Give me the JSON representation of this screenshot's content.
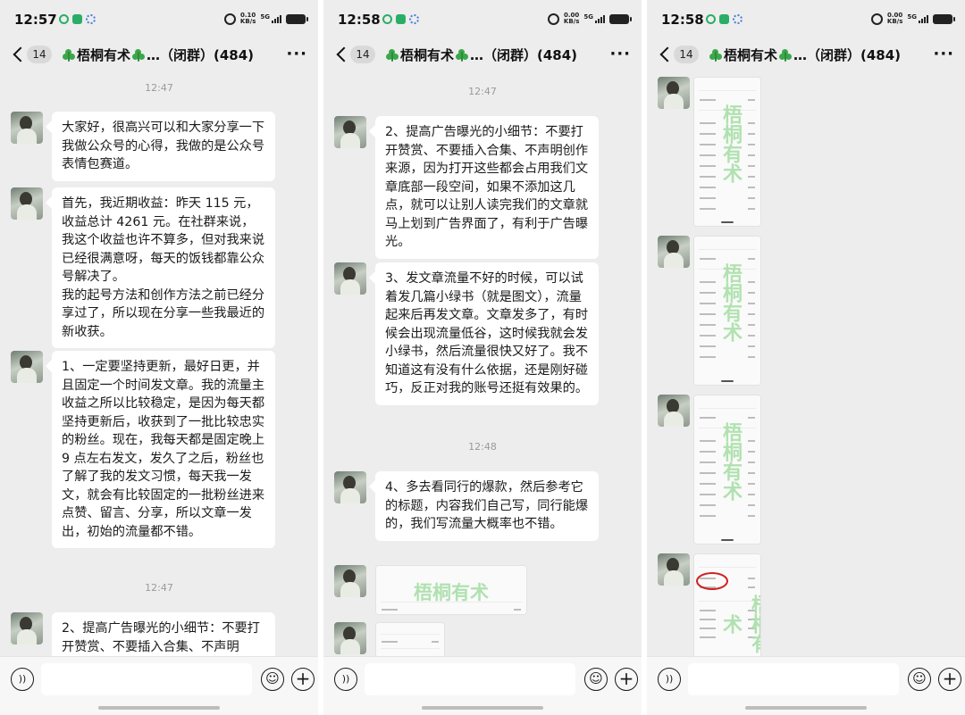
{
  "screens": [
    {
      "status": {
        "time": "12:57",
        "net_rate": "0.10",
        "net_unit": "KB/s",
        "net_type": "5G"
      },
      "nav": {
        "back_count": "14",
        "title": "梧桐有术",
        "title_suffix": "…（闭群）(484)"
      },
      "stamps": [
        "12:47",
        "12:47"
      ],
      "messages": [
        "大家好，很高兴可以和大家分享一下我做公众号的心得，我做的是公众号表情包赛道。",
        "首先，我近期收益：昨天 115 元，收益总计 4261 元。在社群来说，我这个收益也许不算多，但对我来说已经很满意呀，每天的饭钱都靠公众号解决了。\n我的起号方法和创作方法之前已经分享过了，所以现在分享一些我最近的新收获。",
        "1、一定要坚持更新，最好日更，并且固定一个时间发文章。我的流量主收益之所以比较稳定，是因为每天都坚持更新后，收获到了一批比较忠实的粉丝。现在，我每天都是固定晚上 9 点左右发文，发久了之后，粉丝也了解了我的发文习惯，每天我一发文，就会有比较固定的一批粉丝进来点赞、留言、分享，所以文章一发出，初始的流量都不错。",
        "2、提高广告曝光的小细节：不要打开赞赏、不要插入合集、不声明"
      ]
    },
    {
      "status": {
        "time": "12:58",
        "net_rate": "0.00",
        "net_unit": "KB/s",
        "net_type": "5G"
      },
      "nav": {
        "back_count": "14",
        "title": "梧桐有术",
        "title_suffix": "…（闭群）(484)"
      },
      "stamps": [
        "12:47",
        "12:48"
      ],
      "messages": [
        "2、提高广告曝光的小细节：不要打开赞赏、不要插入合集、不声明创作来源，因为打开这些都会占用我们文章底部一段空间，如果不添加这几点，就可以让别人读完我们的文章就马上划到广告界面了，有利于广告曝光。",
        "3、发文章流量不好的时候，可以试着发几篇小绿书（就是图文），流量起来后再发文章。文章发多了，有时候会出现流量低谷，这时候我就会发小绿书，然后流量很快又好了。我不知道这有没有什么依据，还是刚好碰巧，反正对我的账号还挺有效果的。",
        "4、多去看同行的爆款，然后参考它的标题，内容我们自己写，同行能爆的，我们写流量大概率也不错。"
      ],
      "image_watermark": "梧桐有术"
    },
    {
      "status": {
        "time": "12:58",
        "net_rate": "0.00",
        "net_unit": "KB/s",
        "net_type": "5G"
      },
      "nav": {
        "back_count": "14",
        "title": "梧桐有术",
        "title_suffix": "…（闭群）(484)"
      },
      "image_watermark": "梧桐有术"
    }
  ],
  "icons": {
    "back": "chevron-left-icon",
    "more": "more-icon",
    "voice": "voice-icon",
    "emoji": "emoji-icon",
    "plus": "plus-icon"
  },
  "colors": {
    "chat_bg": "#ededed",
    "bubble": "#ffffff",
    "watermark": "#a9dfa8",
    "clover": "#3aa84a",
    "highlight_circle": "#d21f1f"
  }
}
